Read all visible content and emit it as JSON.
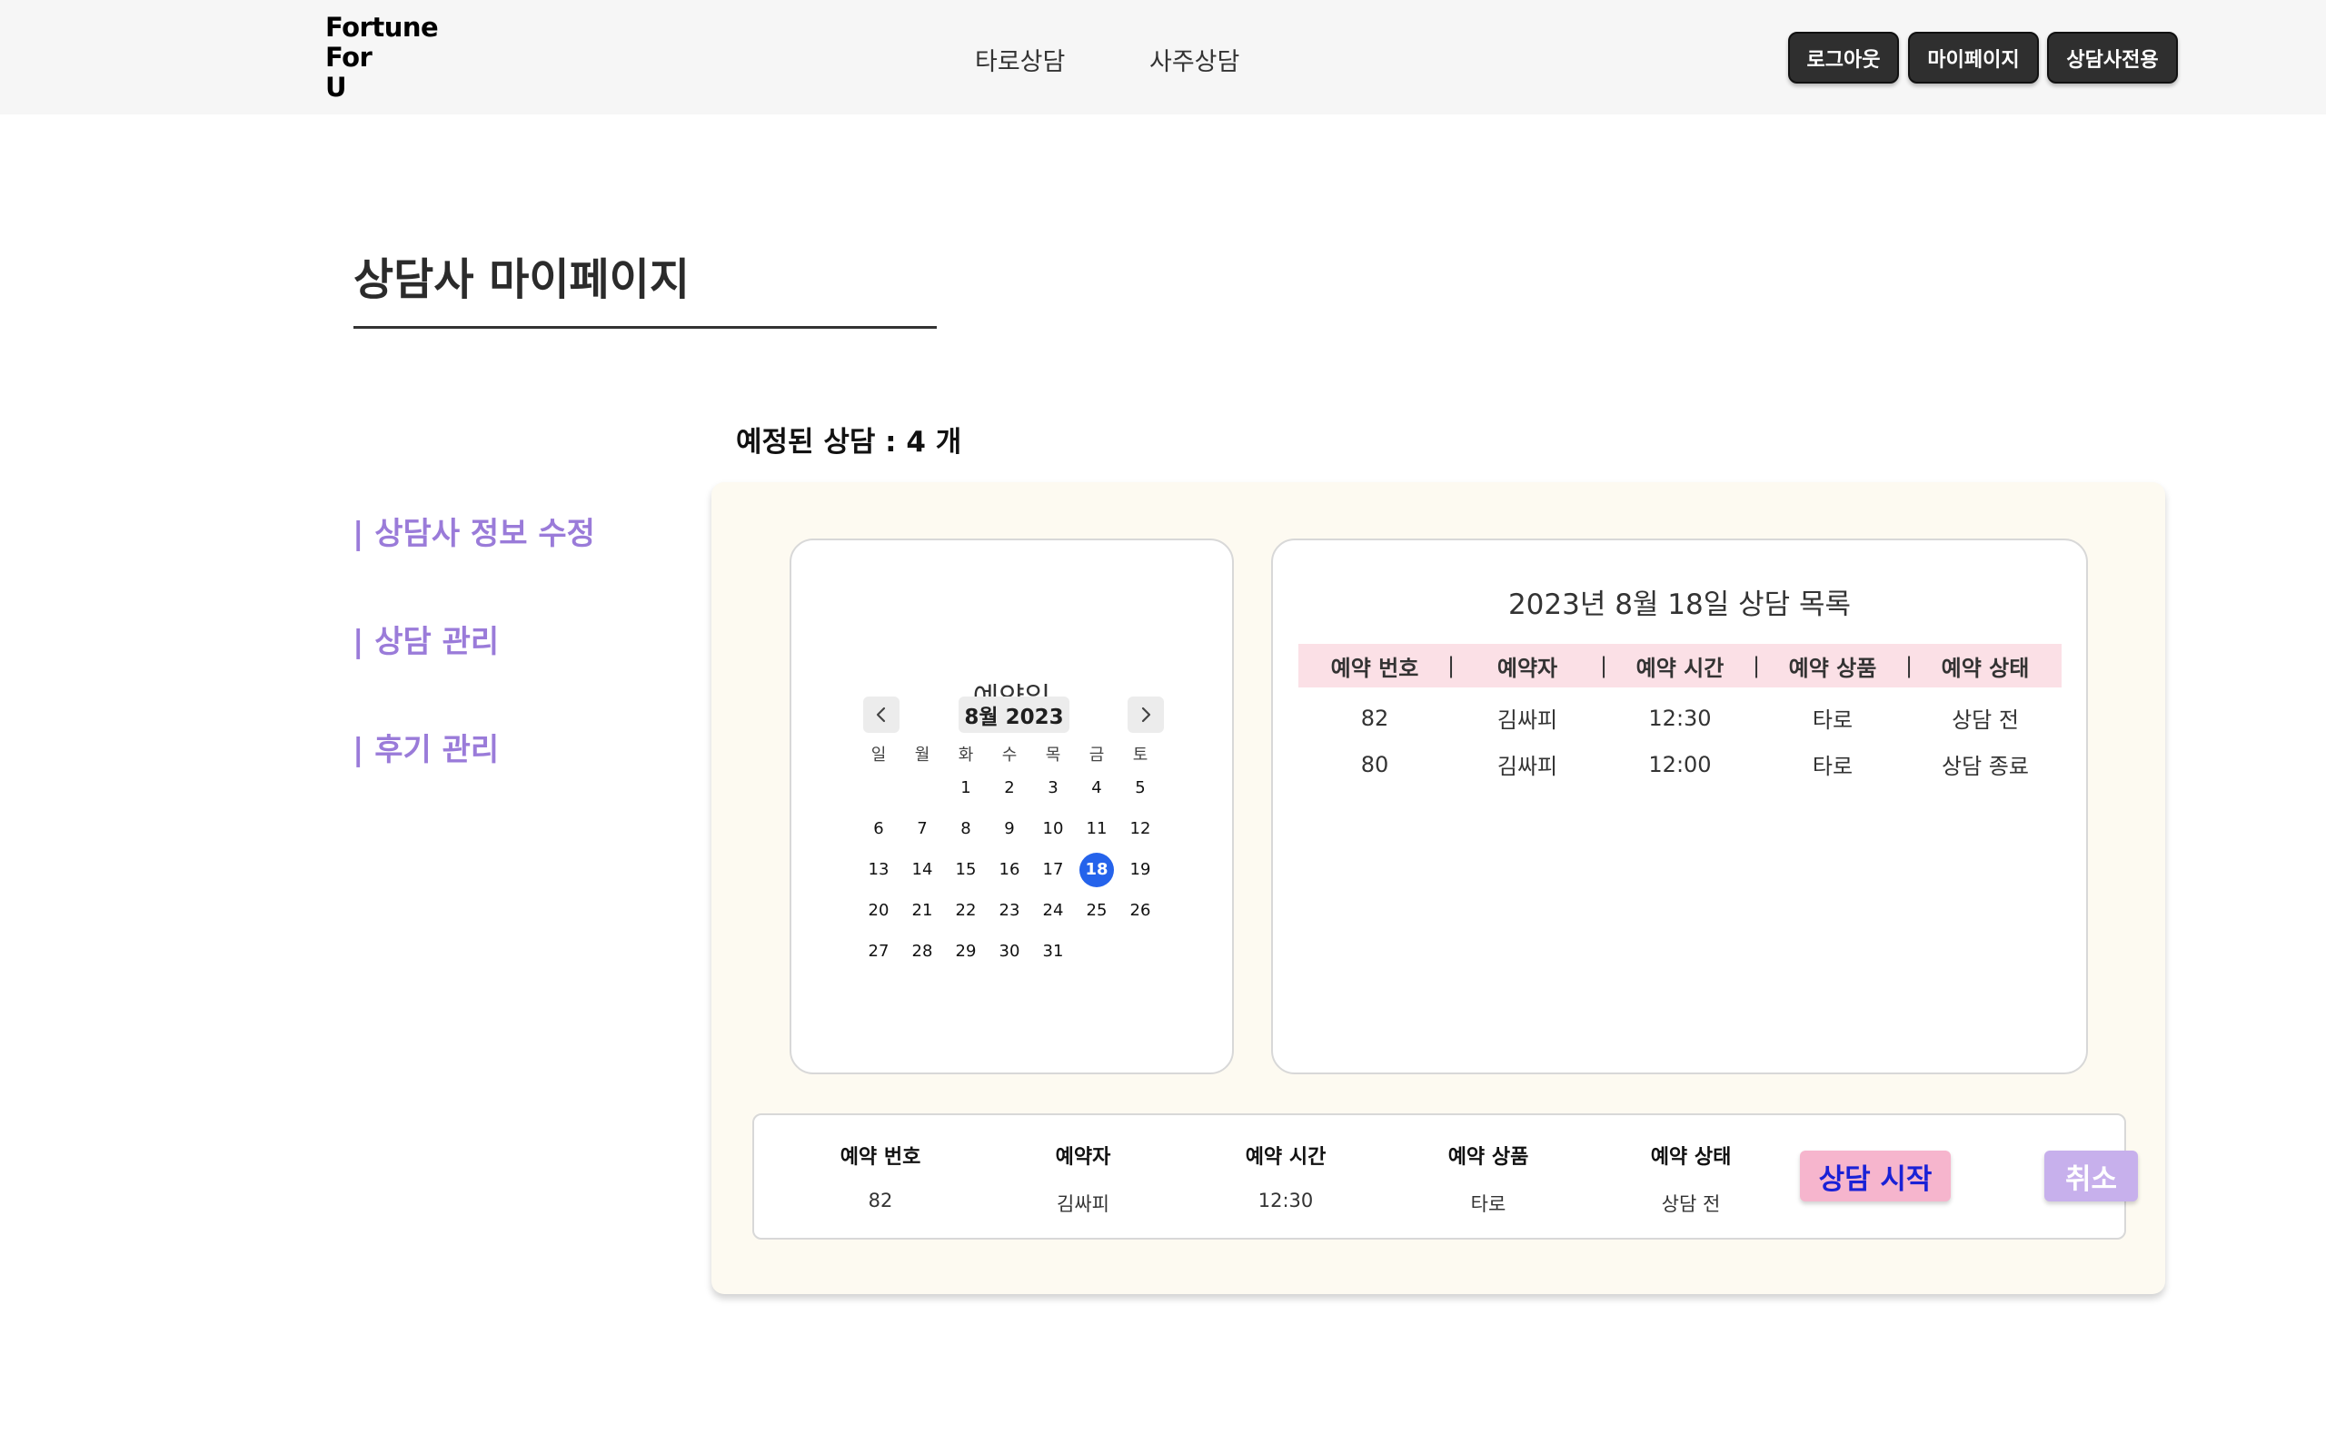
{
  "header": {
    "logo_lines": [
      "Fortune",
      "For",
      "U"
    ],
    "nav": {
      "tarot": "타로상담",
      "saju": "사주상담"
    },
    "buttons": {
      "logout": "로그아웃",
      "mypage": "마이페이지",
      "counselor_only": "상담사전용"
    },
    "background_color": "#f6f6f6"
  },
  "page": {
    "title": "상담사 마이페이지"
  },
  "sidebar": {
    "items": [
      {
        "label": "| 상담사 정보 수정"
      },
      {
        "label": "| 상담 관리"
      },
      {
        "label": "| 후기 관리"
      }
    ],
    "accent_color": "#9a7bd9"
  },
  "summary": {
    "scheduled_label": "예정된 상담 : 4 개"
  },
  "calendar": {
    "title": "예약일",
    "month_label": "8월 2023",
    "weekdays": [
      "일",
      "월",
      "화",
      "수",
      "목",
      "금",
      "토"
    ],
    "weeks": [
      [
        "",
        "",
        "1",
        "2",
        "3",
        "4",
        "5"
      ],
      [
        "6",
        "7",
        "8",
        "9",
        "10",
        "11",
        "12"
      ],
      [
        "13",
        "14",
        "15",
        "16",
        "17",
        "18",
        "19"
      ],
      [
        "20",
        "21",
        "22",
        "23",
        "24",
        "25",
        "26"
      ],
      [
        "27",
        "28",
        "29",
        "30",
        "31",
        "",
        ""
      ]
    ],
    "selected_day": "18",
    "selected_color": "#2563eb",
    "icons": {
      "prev": "chevron-left-icon",
      "next": "chevron-right-icon"
    }
  },
  "reservation_list": {
    "title": "2023년 8월 18일 상담 목록",
    "columns": [
      "예약 번호",
      "예약자",
      "예약 시간",
      "예약 상품",
      "예약 상태"
    ],
    "separator": "|",
    "rows": [
      [
        "82",
        "김싸피",
        "12:30",
        "타로",
        "상담 전"
      ],
      [
        "80",
        "김싸피",
        "12:00",
        "타로",
        "상담 종료"
      ]
    ],
    "header_color": "#fbe0e6"
  },
  "detail": {
    "fields": [
      {
        "label": "예약 번호",
        "value": "82"
      },
      {
        "label": "예약자",
        "value": "김싸피"
      },
      {
        "label": "예약 시간",
        "value": "12:30"
      },
      {
        "label": "예약 상품",
        "value": "타로"
      },
      {
        "label": "예약 상태",
        "value": "상담 전"
      }
    ],
    "start_button": "상담 시작",
    "cancel_button": "취소",
    "start_color": "#f6b5cd",
    "cancel_color": "#c7b0ec"
  },
  "panel_color": "#fdfaf1"
}
